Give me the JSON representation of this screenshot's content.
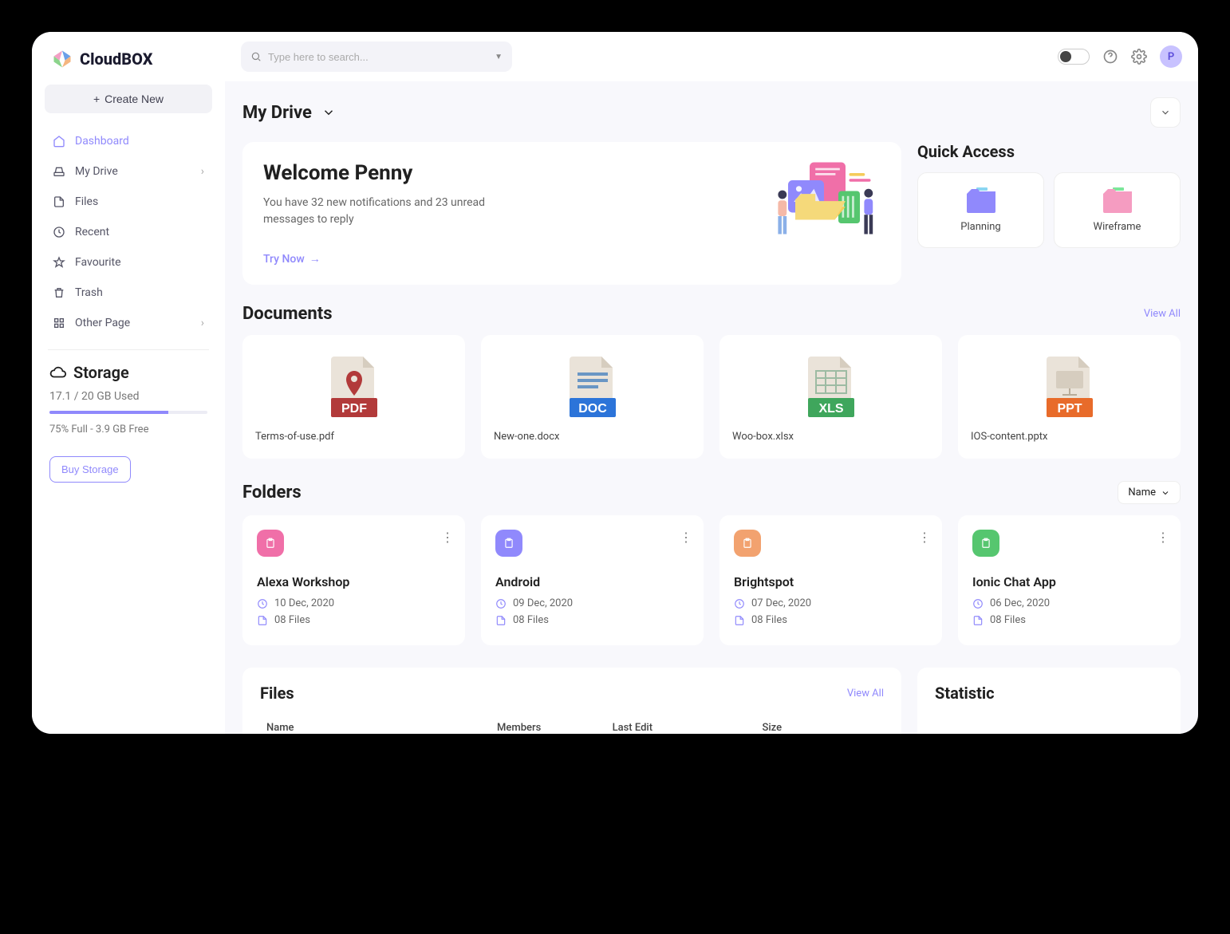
{
  "brand": "CloudBOX",
  "search": {
    "placeholder": "Type here to search..."
  },
  "avatar_initial": "P",
  "sidebar": {
    "create_label": "Create New",
    "items": [
      {
        "label": "Dashboard",
        "icon": "home",
        "active": true
      },
      {
        "label": "My Drive",
        "icon": "drive",
        "chevron": true
      },
      {
        "label": "Files",
        "icon": "file"
      },
      {
        "label": "Recent",
        "icon": "clock"
      },
      {
        "label": "Favourite",
        "icon": "star"
      },
      {
        "label": "Trash",
        "icon": "trash"
      },
      {
        "label": "Other Page",
        "icon": "grid",
        "chevron": true
      }
    ],
    "storage": {
      "title": "Storage",
      "used_text": "17.1 / 20 GB Used",
      "percent": 75,
      "desc": "75% Full - 3.9 GB Free",
      "buy_label": "Buy Storage"
    }
  },
  "page_title": "My Drive",
  "hero": {
    "title": "Welcome Penny",
    "subtitle": "You have 32 new notifications and 23 unread messages to reply",
    "cta": "Try Now"
  },
  "quick_access": {
    "title": "Quick Access",
    "items": [
      {
        "label": "Planning",
        "color": "#9089fc",
        "accent": "#8bd6f2"
      },
      {
        "label": "Wireframe",
        "color": "#f59cc1",
        "accent": "#7be69a"
      }
    ]
  },
  "documents": {
    "title": "Documents",
    "view_all": "View All",
    "items": [
      {
        "name": "Terms-of-use.pdf",
        "type": "PDF",
        "color": "#b23a3a"
      },
      {
        "name": "New-one.docx",
        "type": "DOC",
        "color": "#2c74d9"
      },
      {
        "name": "Woo-box.xlsx",
        "type": "XLS",
        "color": "#3fa65c"
      },
      {
        "name": "IOS-content.pptx",
        "type": "PPT",
        "color": "#e86b2a"
      }
    ]
  },
  "folders": {
    "title": "Folders",
    "sort_label": "Name",
    "items": [
      {
        "name": "Alexa Workshop",
        "date": "10 Dec, 2020",
        "files": "08 Files",
        "color": "#f06fa8"
      },
      {
        "name": "Android",
        "date": "09 Dec, 2020",
        "files": "08 Files",
        "color": "#9089fc"
      },
      {
        "name": "Brightspot",
        "date": "07 Dec, 2020",
        "files": "08 Files",
        "color": "#f2a26f"
      },
      {
        "name": "Ionic Chat App",
        "date": "06 Dec, 2020",
        "files": "08 Files",
        "color": "#56c66f"
      }
    ]
  },
  "files_table": {
    "title": "Files",
    "view_all": "View All",
    "columns": [
      "Name",
      "Members",
      "Last Edit",
      "Size"
    ]
  },
  "statistic": {
    "title": "Statistic"
  }
}
